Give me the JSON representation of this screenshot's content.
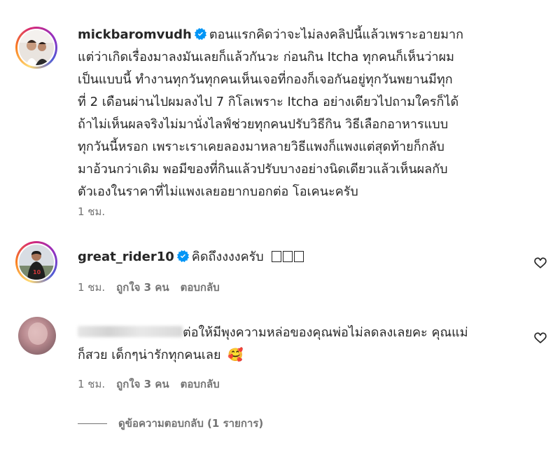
{
  "comments": [
    {
      "username": "mickbaromvudh",
      "verified": true,
      "lines": [
        "ตอนแรกคิดว่าจะไม่ลงคลิปนี้แล้วเพราะอายมาก",
        "แต่ว่าเกิดเรื่องมาลงมันเลยก็แล้วกันวะ ก่อนกิน Itcha ทุกคนก็เห็นว่าผม",
        "เป็นแบบนี้ ทำงานทุกวันทุกคนเห็นเจอที่กองก็เจอกันอยู่ทุกวันพยานมีทุก",
        "ที่ 2 เดือนผ่านไปผมลงไป 7 กิโลเพราะ Itcha อย่างเดียวไปถามใครก็ได้",
        "ถ้าไม่เห็นผลจริงไม่มานั่งไลฟ์ช่วยทุกคนปรับวิธีกิน วิธีเลือกอาหารแบบ",
        "ทุกวันนี้หรอก เพราะเราเคยลองมาหลายวิธีแพงก็แพงแต่สุดท้ายก็กลับ",
        "มาอ้วนกว่าเดิม พอมีของที่กินแล้วปรับบางอย่างนิดเดียวแล้วเห็นผลกับ",
        "ตัวเองในราคาที่ไม่แพงเลยอยากบอกต่อ โอเคนะครับ"
      ],
      "time": "1 ชม."
    },
    {
      "username": "great_rider10",
      "verified": true,
      "text": "คิดถึงงงงครับ",
      "emoji_boxes": 3,
      "time": "1 ชม.",
      "likes": "ถูกใจ 3 คน",
      "reply": "ตอบกลับ"
    },
    {
      "username_blurred": true,
      "line1": "ต่อให้มีพุงความหล่อของคุณพ่อไม่ลดลงเลยคะ คุณแม่",
      "line2": "ก็สวย เด็กๆน่ารักทุกคนเลย",
      "emoji": "🥰",
      "time": "1 ชม.",
      "likes": "ถูกใจ 3 คน",
      "reply": "ตอบกลับ"
    }
  ],
  "view_replies": "ดูข้อความตอบกลับ (1 รายการ)",
  "icons": {
    "verified": "verified-badge-icon",
    "heart": "heart-outline-icon"
  },
  "colors": {
    "verified_blue": "#0095f6",
    "text": "#262626",
    "secondary": "#737373"
  }
}
